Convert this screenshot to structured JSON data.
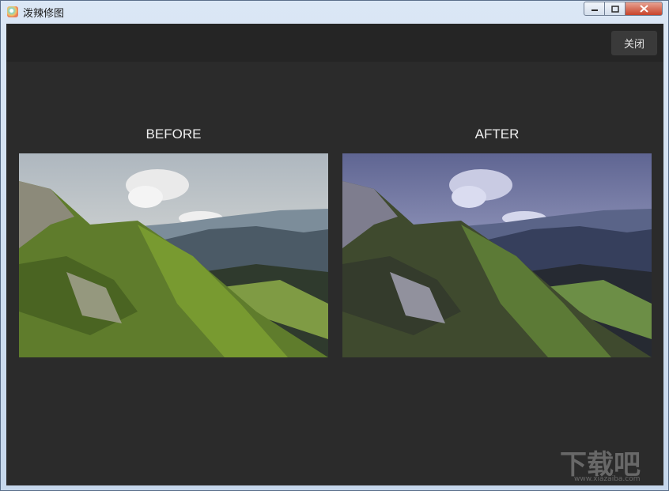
{
  "window": {
    "title": "泼辣修图",
    "minimize_icon": "minimize-icon",
    "maximize_icon": "maximize-icon",
    "close_icon": "close-icon"
  },
  "toolbar": {
    "close_label": "关闭"
  },
  "comparison": {
    "before_label": "BEFORE",
    "after_label": "AFTER"
  },
  "watermark": {
    "text": "下载吧",
    "url": "www.xiazaiba.com"
  }
}
